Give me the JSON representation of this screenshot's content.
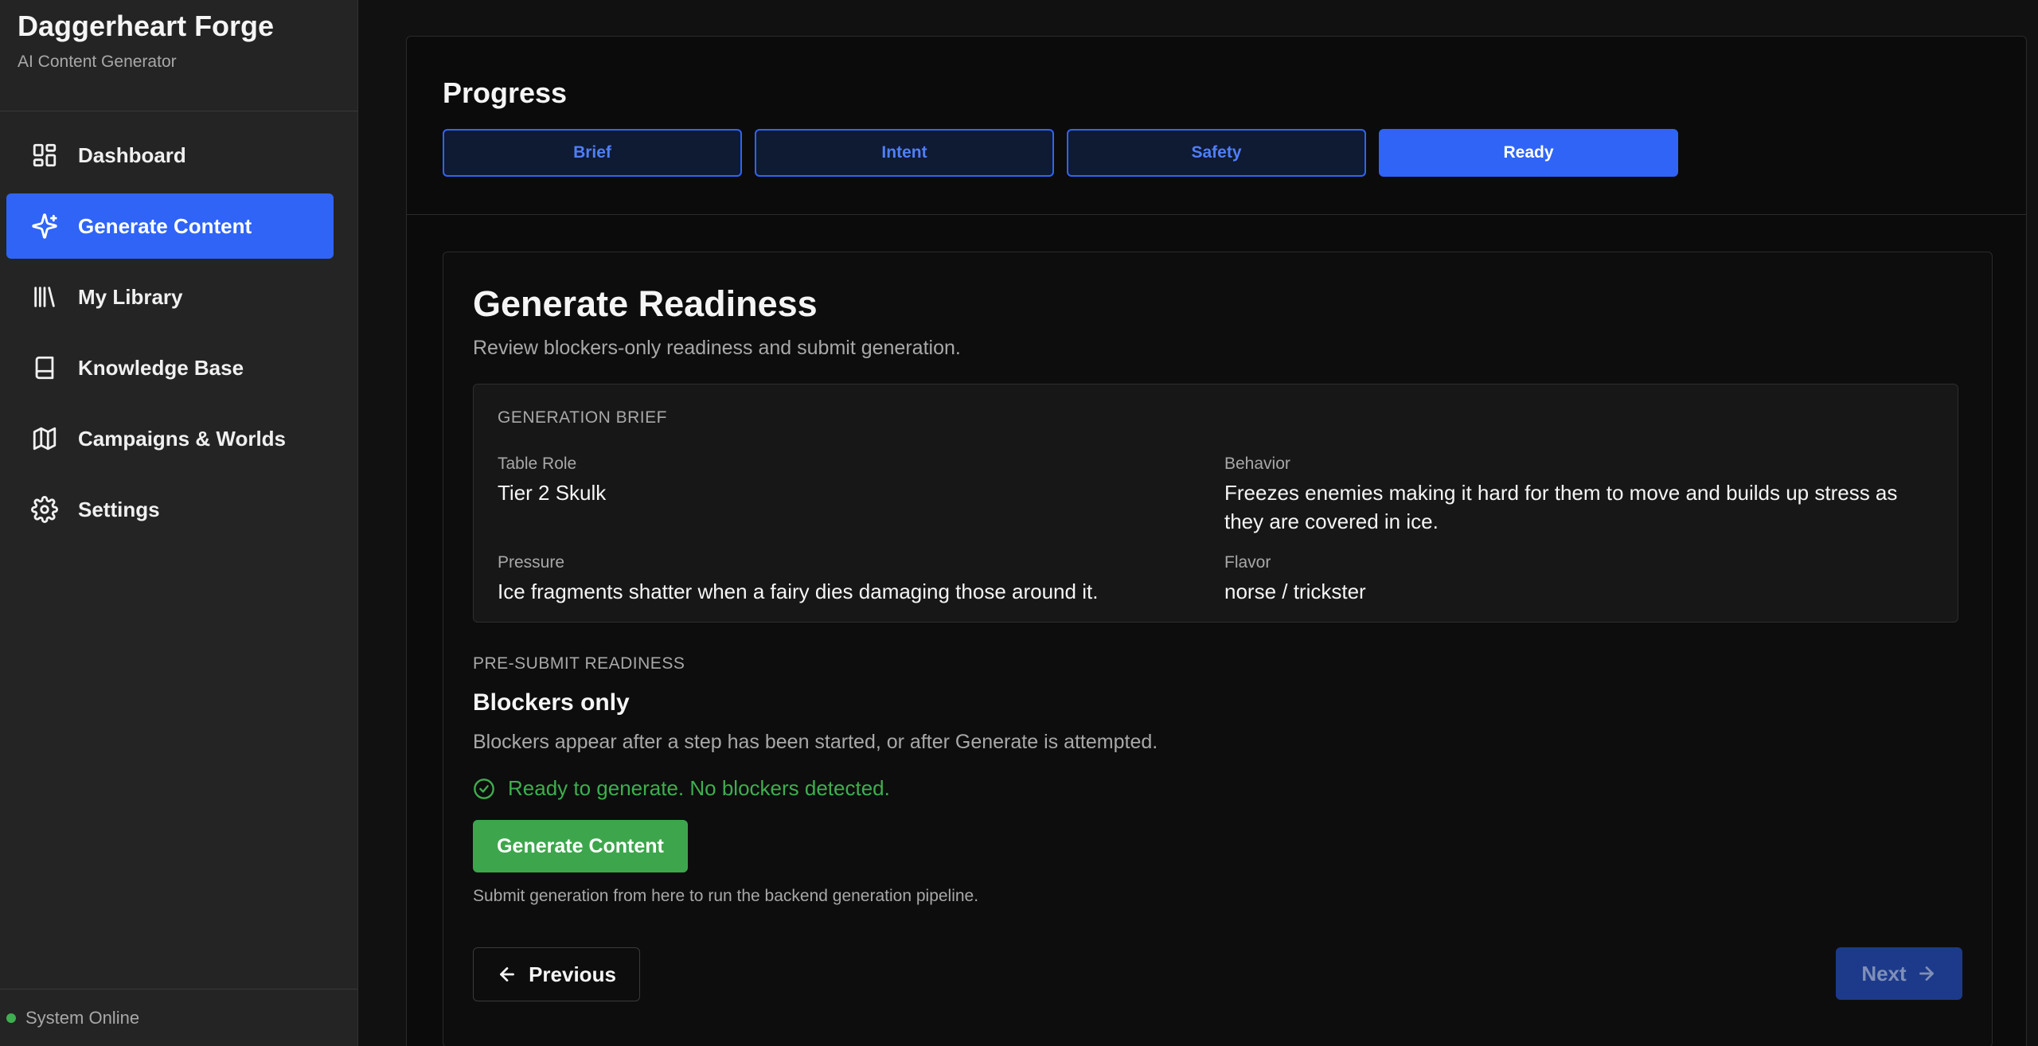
{
  "sidebar": {
    "brand_title": "Daggerheart Forge",
    "brand_subtitle": "AI Content Generator",
    "items": [
      {
        "label": "Dashboard",
        "icon": "dashboard-icon",
        "active": false
      },
      {
        "label": "Generate Content",
        "icon": "sparkle-icon",
        "active": true
      },
      {
        "label": "My Library",
        "icon": "library-icon",
        "active": false
      },
      {
        "label": "Knowledge Base",
        "icon": "book-icon",
        "active": false
      },
      {
        "label": "Campaigns & Worlds",
        "icon": "map-icon",
        "active": false
      },
      {
        "label": "Settings",
        "icon": "gear-icon",
        "active": false
      }
    ],
    "status": "System Online",
    "status_color": "#3fae4f"
  },
  "progress": {
    "title": "Progress",
    "steps": [
      {
        "label": "Brief",
        "active": false
      },
      {
        "label": "Intent",
        "active": false
      },
      {
        "label": "Safety",
        "active": false
      },
      {
        "label": "Ready",
        "active": true
      }
    ]
  },
  "card": {
    "title": "Generate Readiness",
    "subtitle": "Review blockers-only readiness and submit generation.",
    "brief": {
      "label": "GENERATION BRIEF",
      "table_role_label": "Table Role",
      "table_role_value": "Tier 2 Skulk",
      "behavior_label": "Behavior",
      "behavior_value": "Freezes enemies making it hard for them to move and builds up stress as they are covered in ice.",
      "pressure_label": "Pressure",
      "pressure_value": "Ice fragments shatter when a fairy dies damaging those around it.",
      "flavor_label": "Flavor",
      "flavor_value": "norse / trickster"
    },
    "readiness": {
      "label": "PRE-SUBMIT READINESS",
      "heading": "Blockers only",
      "description": "Blockers appear after a step has been started, or after Generate is attempted.",
      "ready_message": "Ready to generate. No blockers detected.",
      "generate_label": "Generate Content",
      "generate_hint": "Submit generation from here to run the backend generation pipeline."
    },
    "nav": {
      "previous_label": "Previous",
      "next_label": "Next"
    }
  },
  "colors": {
    "accent": "#2f64f6",
    "success": "#3da64c",
    "background": "#111111"
  }
}
